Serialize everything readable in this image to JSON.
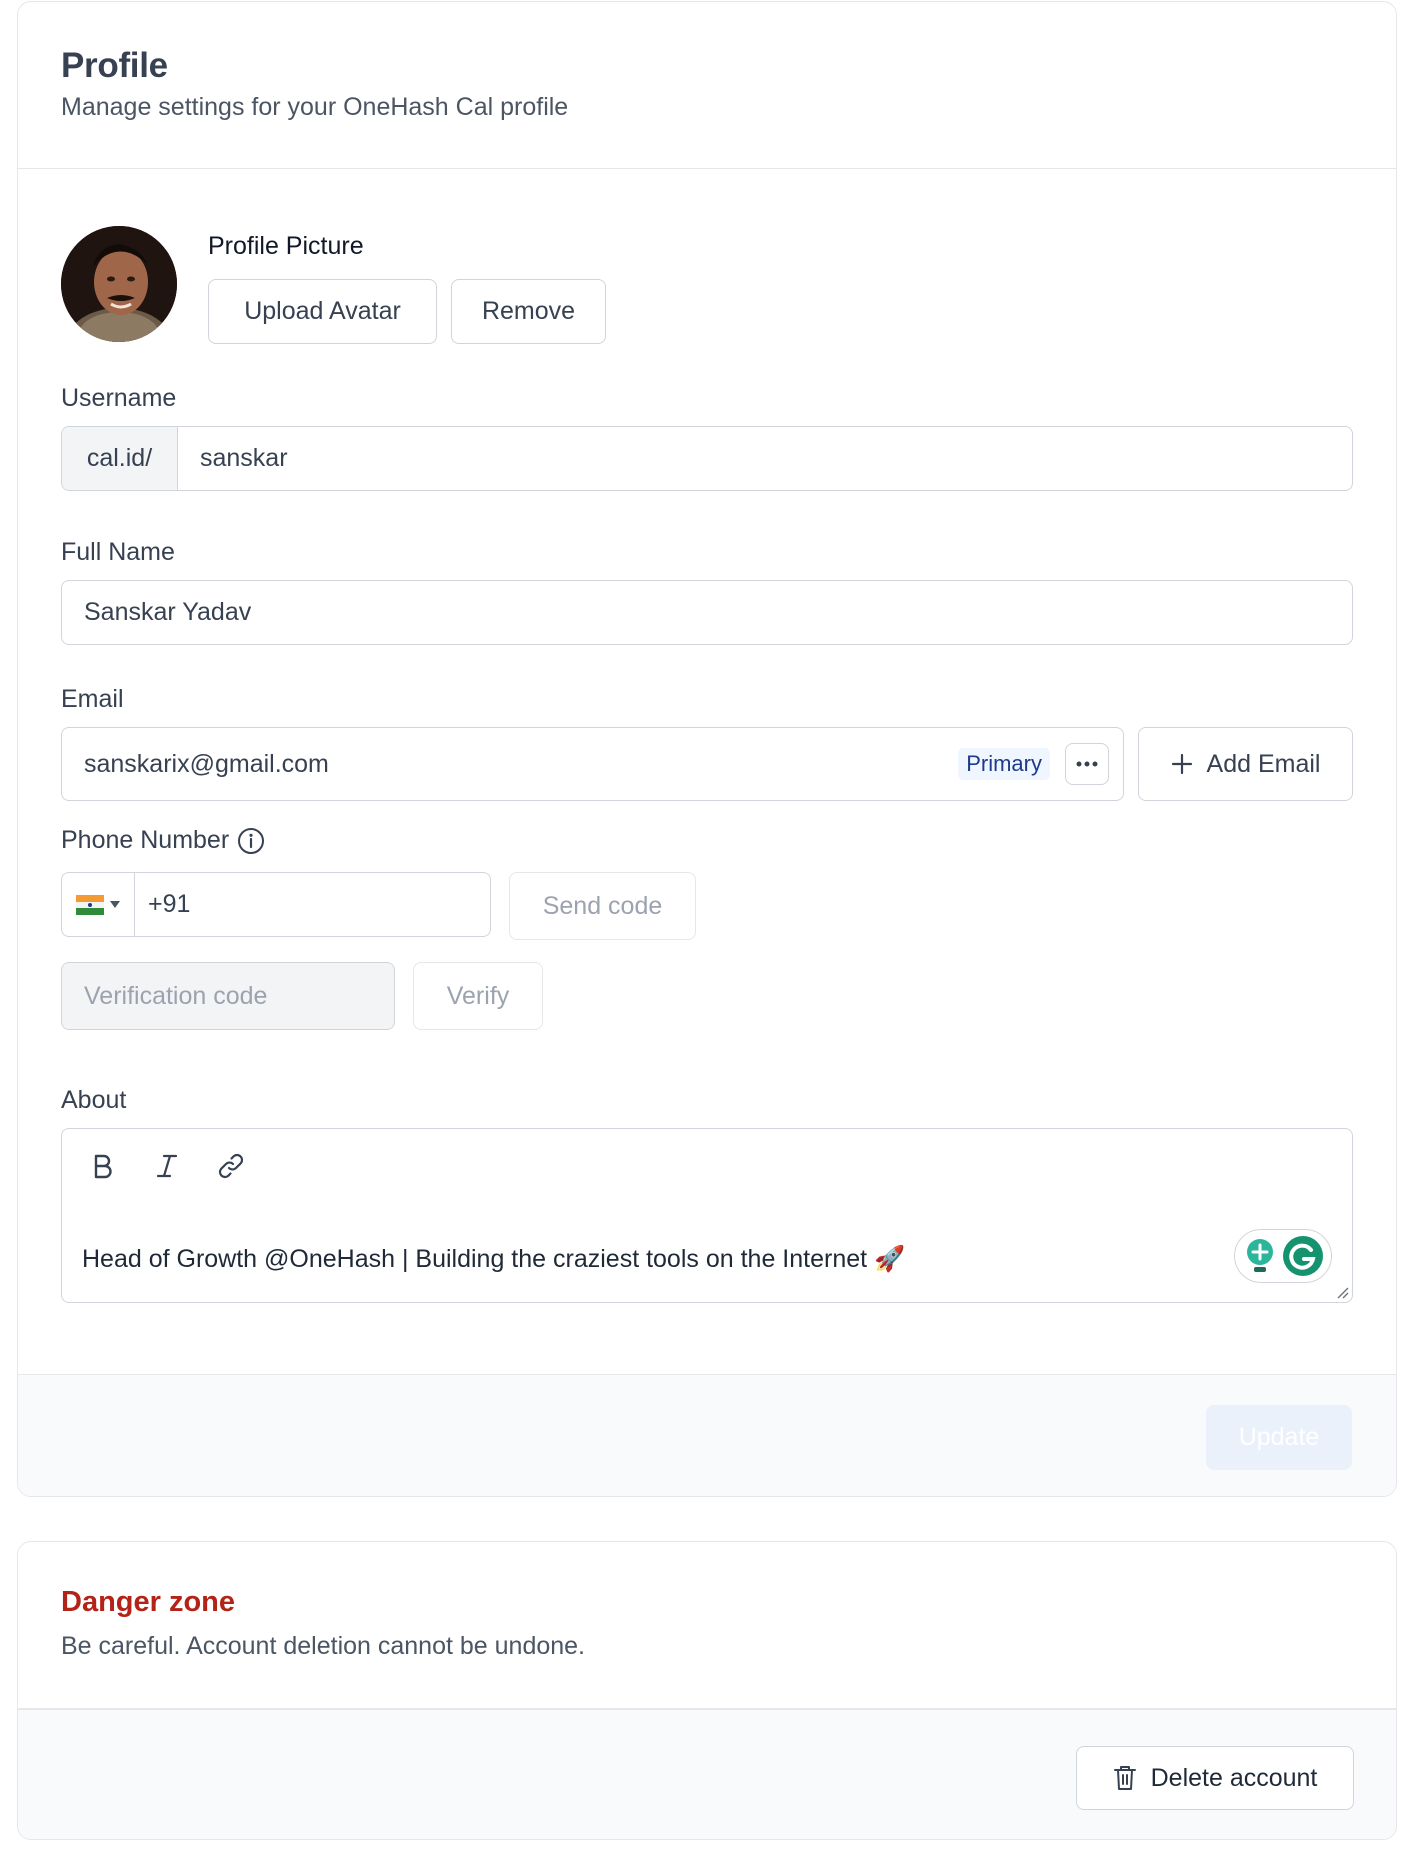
{
  "profile": {
    "title": "Profile",
    "description": "Manage settings for your OneHash Cal profile",
    "picture_label": "Profile Picture",
    "upload_label": "Upload Avatar",
    "remove_label": "Remove",
    "username_label": "Username",
    "username_prefix": "cal.id/",
    "username_value": "sanskar",
    "fullname_label": "Full Name",
    "fullname_value": "Sanskar Yadav",
    "email_label": "Email",
    "email_value": "sanskarix@gmail.com",
    "email_badge": "Primary",
    "add_email_label": "Add Email",
    "phone_label": "Phone Number",
    "phone_value": "+91",
    "send_code_label": "Send code",
    "verification_placeholder": "Verification code",
    "verify_label": "Verify",
    "about_label": "About",
    "about_value": "Head of Growth @OneHash | Building the craziest tools on the Internet 🚀",
    "update_label": "Update"
  },
  "danger": {
    "title": "Danger zone",
    "description": "Be careful. Account deletion cannot be undone.",
    "delete_label": "Delete account"
  },
  "colors": {
    "danger_title": "#b42318",
    "badge_text": "#1e3a8a",
    "badge_bg": "#eff6ff",
    "update_bg": "#eaf1fb"
  },
  "icons": [
    "info-icon",
    "plus-icon",
    "more-icon",
    "bold-icon",
    "italic-icon",
    "link-icon",
    "trash-icon",
    "flag-icon",
    "chevron-down-icon",
    "grammarly-icon"
  ]
}
